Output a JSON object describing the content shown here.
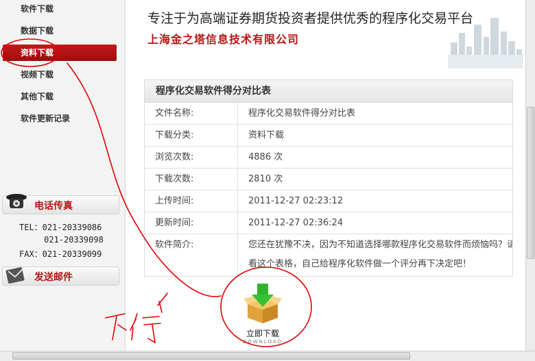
{
  "sidebar": {
    "items": [
      {
        "label": "软件下载"
      },
      {
        "label": "数据下载"
      },
      {
        "label": "资料下载",
        "active": true
      },
      {
        "label": "视频下载"
      },
      {
        "label": "其他下载"
      },
      {
        "label": "软件更新记录"
      }
    ],
    "phone_box": {
      "title": "电话传真"
    },
    "contact": {
      "tel_line": "TEL：021-20339086",
      "tel_line2": "     021-20339098",
      "fax_line": "FAX：021-20339099"
    },
    "mail_box": {
      "title": "发送邮件"
    }
  },
  "header": {
    "slogan": "专注于为高端证券期货投资者提供优秀的程序化交易平台",
    "company": "上海金之塔信息技术有限公司"
  },
  "detail": {
    "title": "程序化交易软件得分对比表",
    "rows": [
      {
        "label": "文件名称:",
        "value": "程序化交易软件得分对比表"
      },
      {
        "label": "下载分类:",
        "value": "资料下载"
      },
      {
        "label": "浏览次数:",
        "value": "4886 次"
      },
      {
        "label": "下载次数:",
        "value": "2810 次"
      },
      {
        "label": "上传时间:",
        "value": "2011-12-27 02:23:12"
      },
      {
        "label": "更新时间:",
        "value": "2011-12-27 02:36:24"
      },
      {
        "label": "软件简介:",
        "value": "您还在犹豫不决，因为不知道选择哪款程序化交易软件而烦恼吗？请看这个表格，自己给程序化软件做一个评分再下决定吧！"
      }
    ]
  },
  "download": {
    "label": "立即下载",
    "sublabel": "DOWNLOAD"
  },
  "annotation": {
    "handwriting": "不行"
  },
  "colors": {
    "accent": "#b81414",
    "active_nav": "#b01212",
    "annotation": "#e00000"
  }
}
